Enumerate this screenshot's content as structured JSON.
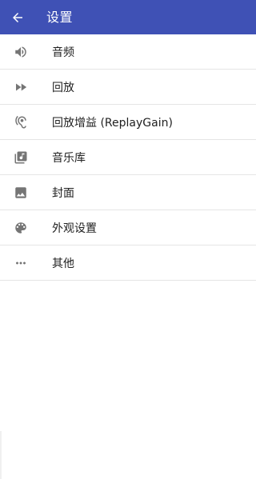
{
  "theme": {
    "primary": "#3f51b5",
    "text": "#212121",
    "icon": "#757575",
    "divider": "#e5e5e5"
  },
  "toolbar": {
    "title": "设置",
    "back_icon": "arrow-left-icon"
  },
  "settings": [
    {
      "label": "音频",
      "icon": "volume-icon"
    },
    {
      "label": "回放",
      "icon": "fast-forward-icon"
    },
    {
      "label": "回放增益 (ReplayGain)",
      "icon": "hearing-icon"
    },
    {
      "label": "音乐库",
      "icon": "music-library-icon"
    },
    {
      "label": "封面",
      "icon": "image-icon"
    },
    {
      "label": "外观设置",
      "icon": "palette-icon"
    },
    {
      "label": "其他",
      "icon": "more-horiz-icon"
    }
  ]
}
